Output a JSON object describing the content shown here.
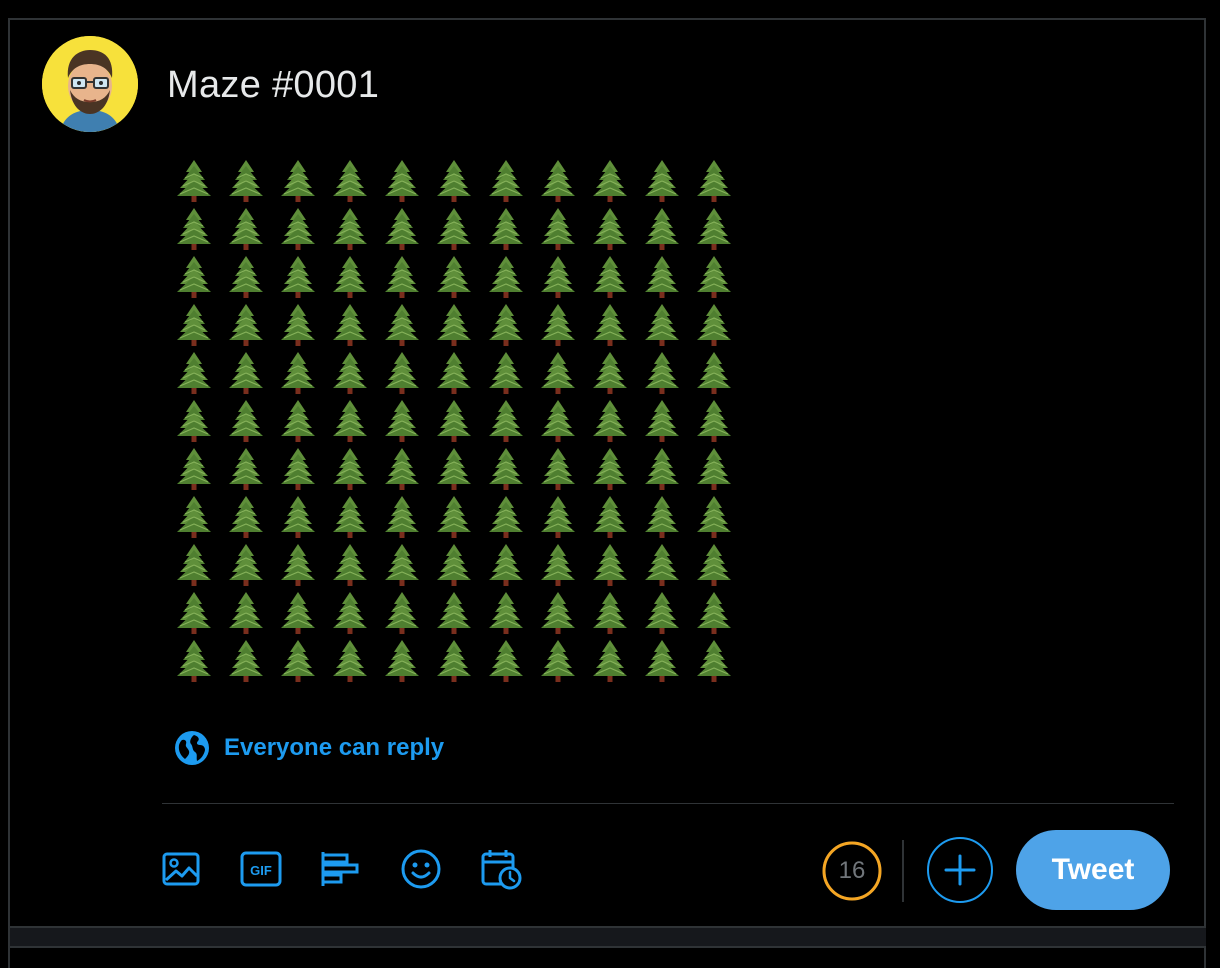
{
  "tweet": {
    "text": "Maze #0001",
    "grid": {
      "rows": 11,
      "cols": 11,
      "cell": "🌲"
    }
  },
  "reply_setting": {
    "label": "Everyone can reply",
    "icon": "globe-icon"
  },
  "toolbar": {
    "icons": [
      "image-icon",
      "gif-icon",
      "poll-icon",
      "emoji-icon",
      "schedule-icon"
    ]
  },
  "char_counter": {
    "remaining": "16",
    "color": "#f5a623"
  },
  "actions": {
    "add_icon": "plus-icon",
    "tweet_label": "Tweet"
  },
  "colors": {
    "accent": "#1d9bf0",
    "tweet_button": "#4ea3e8",
    "background": "#000000",
    "avatar_bg": "#f7e13b"
  }
}
